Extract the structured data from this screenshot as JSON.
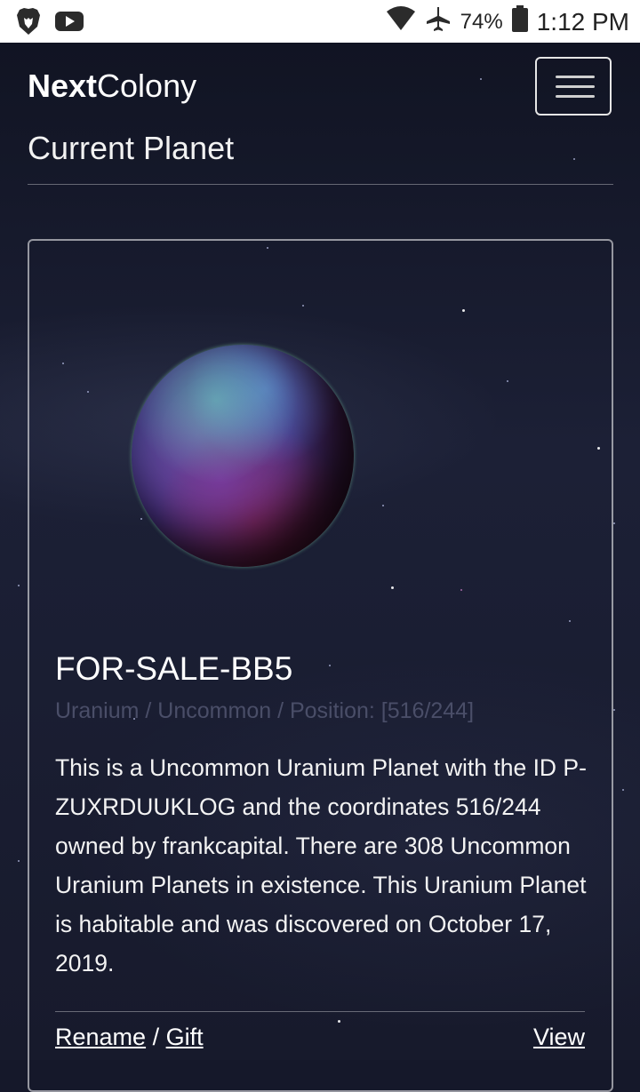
{
  "status_bar": {
    "battery_percent": "74%",
    "time": "1:12 PM",
    "icons": [
      "brave-lion-icon",
      "youtube-icon",
      "wifi-icon",
      "airplane-icon",
      "battery-icon"
    ]
  },
  "navbar": {
    "brand_bold": "Next",
    "brand_regular": "Colony",
    "menu_icon": "hamburger-icon"
  },
  "page": {
    "title": "Current Planet"
  },
  "planet": {
    "name": "FOR-SALE-BB5",
    "meta": "Uranium / Uncommon / Position: [516/244]",
    "description": "This is a Uncommon Uranium Planet with the ID P-ZUXRDUUKLOG and the coordinates 516/244 owned by frankcapital. There are 308 Uncommon Uranium Planets in existence. This Uranium Planet is habitable and was discovered on October 17, 2019.",
    "actions": {
      "rename": "Rename",
      "separator": "/",
      "gift": "Gift",
      "view": "View"
    }
  },
  "colors": {
    "background": "#15182a",
    "meta_text": "#4a4e68",
    "text": "#ffffff"
  }
}
